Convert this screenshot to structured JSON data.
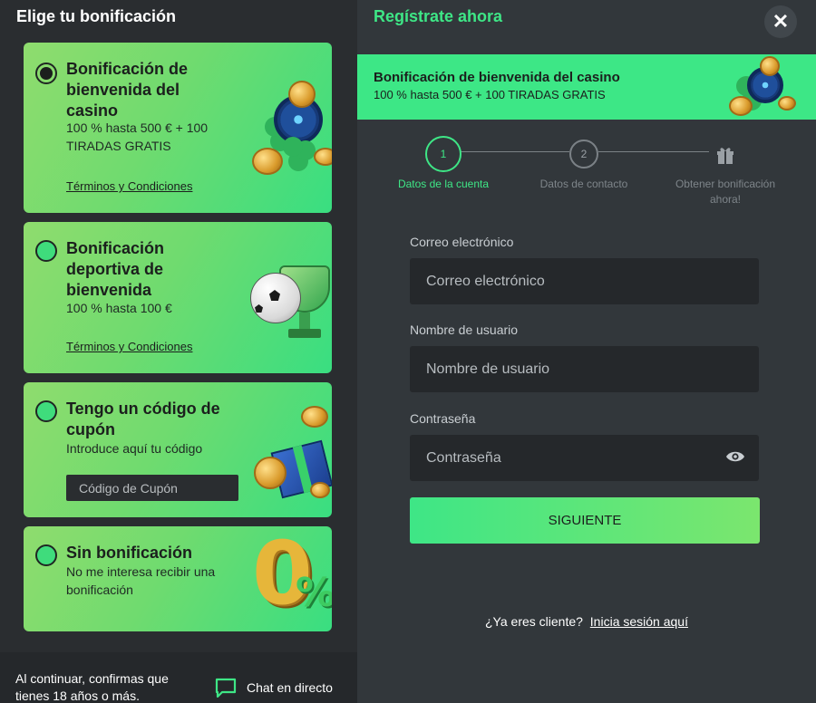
{
  "left": {
    "title": "Elige tu bonificación",
    "cards": [
      {
        "title": "Bonificación de bienvenida del casino",
        "subtitle": "100 % hasta 500 € + 100 TIRADAS GRATIS",
        "terms": "Términos y Condiciones",
        "selected": true
      },
      {
        "title": "Bonificación deportiva de bienvenida",
        "subtitle": "100 % hasta 100 €",
        "terms": "Términos y Condiciones",
        "selected": false
      },
      {
        "title": "Tengo un código de cupón",
        "subtitle": "Introduce aquí tu código",
        "coupon_placeholder": "Código de Cupón",
        "selected": false
      },
      {
        "title": "Sin bonificación",
        "subtitle": "No me interesa recibir una bonificación",
        "art_text": "0",
        "art_percent": "%",
        "selected": false
      }
    ],
    "footer": {
      "age_note": "Al continuar, confirmas que tienes 18 años o más.",
      "chat_label": "Chat en directo"
    }
  },
  "right": {
    "title": "Regístrate ahora",
    "close_icon": "✕",
    "banner": {
      "title": "Bonificación de bienvenida del casino",
      "subtitle": "100 % hasta 500 € + 100 TIRADAS GRATIS"
    },
    "steps": [
      {
        "number": "1",
        "label": "Datos de la cuenta",
        "active": true
      },
      {
        "number": "2",
        "label": "Datos de contacto",
        "active": false
      },
      {
        "icon": "gift-icon",
        "label": "Obtener bonificación ahora!",
        "active": false
      }
    ],
    "form": {
      "email_label": "Correo electrónico",
      "email_placeholder": "Correo electrónico",
      "username_label": "Nombre de usuario",
      "username_placeholder": "Nombre de usuario",
      "password_label": "Contraseña",
      "password_placeholder": "Contraseña",
      "submit_label": "SIGUIENTE"
    },
    "login": {
      "prompt": "¿Ya eres cliente?",
      "link": "Inicia sesión aquí"
    }
  },
  "colors": {
    "accent": "#3ee686",
    "panel_dark": "#2a2d30",
    "panel_right": "#32373b",
    "input_bg": "#25282b"
  }
}
